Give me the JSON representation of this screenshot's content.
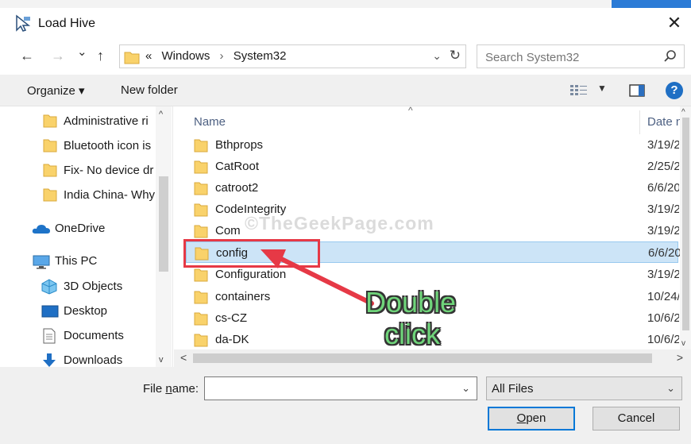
{
  "window": {
    "title": "Load Hive",
    "close_glyph": "✕"
  },
  "nav": {
    "back_glyph": "←",
    "forward_glyph": "→",
    "recent_glyph": "⌄",
    "up_glyph": "↑",
    "address": {
      "overflow": "«",
      "crumbs": [
        "Windows",
        "System32"
      ],
      "separator": "›",
      "dropdown_glyph": "⌄",
      "refresh_glyph": "↻"
    },
    "search": {
      "placeholder": "Search System32"
    }
  },
  "toolbar": {
    "organize_label": "Organize ▾",
    "new_folder_label": "New folder",
    "view_dd": "▼",
    "help_glyph": "?"
  },
  "sidebar": {
    "quick_items": [
      {
        "label": "Administrative ri"
      },
      {
        "label": "Bluetooth icon is"
      },
      {
        "label": "Fix- No device dr"
      },
      {
        "label": "India China- Why"
      }
    ],
    "onedrive_label": "OneDrive",
    "thispc_label": "This PC",
    "pc_items": [
      {
        "label": "3D Objects",
        "icon": "3d-objects-icon"
      },
      {
        "label": "Desktop",
        "icon": "desktop-icon"
      },
      {
        "label": "Documents",
        "icon": "documents-icon"
      },
      {
        "label": "Downloads",
        "icon": "downloads-icon"
      }
    ],
    "scroll_up": "^",
    "scroll_down": "v"
  },
  "filelist": {
    "columns": {
      "name": "Name",
      "date": "Date n"
    },
    "sort_caret": "^",
    "rows": [
      {
        "name": "Bthprops",
        "date": "3/19/2"
      },
      {
        "name": "CatRoot",
        "date": "2/25/2"
      },
      {
        "name": "catroot2",
        "date": "6/6/20"
      },
      {
        "name": "CodeIntegrity",
        "date": "3/19/2"
      },
      {
        "name": "Com",
        "date": "3/19/2"
      },
      {
        "name": "config",
        "date": "6/6/20",
        "selected": true
      },
      {
        "name": "Configuration",
        "date": "3/19/2"
      },
      {
        "name": "containers",
        "date": "10/24/"
      },
      {
        "name": "cs-CZ",
        "date": "10/6/2"
      },
      {
        "name": "da-DK",
        "date": "10/6/2"
      }
    ],
    "scroll_up": "^",
    "scroll_down": "v",
    "hscroll_left": "<",
    "hscroll_right": ">"
  },
  "bottom": {
    "filename_label_pre": "File ",
    "filename_label_u": "n",
    "filename_label_post": "ame:",
    "filename_value": "",
    "dropdown_glyph": "⌄",
    "filter_value": "All Files",
    "open_u": "O",
    "open_rest": "pen",
    "cancel_label": "Cancel"
  },
  "overlay": {
    "watermark": "©TheGeekPage.com",
    "annotation_line1": "Double",
    "annotation_line2": "click",
    "red_color": "#e63946",
    "annotation_color": "#6fd47a"
  }
}
